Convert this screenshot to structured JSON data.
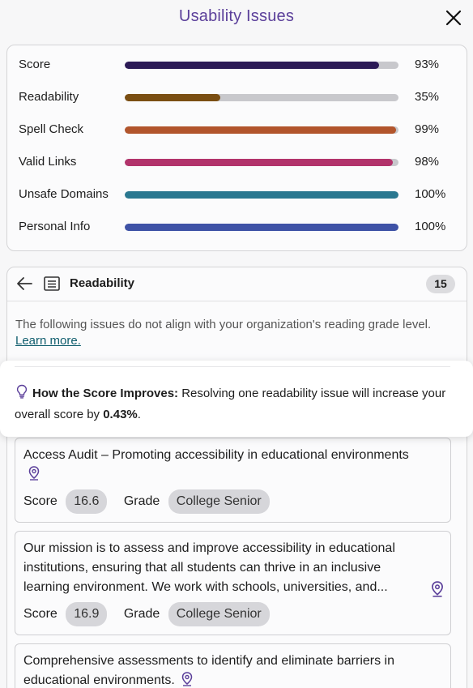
{
  "header": {
    "title": "Usability Issues"
  },
  "metrics": [
    {
      "label": "Score",
      "value": 93,
      "pct": "93%",
      "color": "#2c1a56"
    },
    {
      "label": "Readability",
      "value": 35,
      "pct": "35%",
      "color": "#7a4e12"
    },
    {
      "label": "Spell Check",
      "value": 99,
      "pct": "99%",
      "color": "#b2552c"
    },
    {
      "label": "Valid Links",
      "value": 98,
      "pct": "98%",
      "color": "#b2336b"
    },
    {
      "label": "Unsafe Domains",
      "value": 100,
      "pct": "100%",
      "color": "#2a7890"
    },
    {
      "label": "Personal Info",
      "value": 100,
      "pct": "100%",
      "color": "#3e52a6"
    }
  ],
  "issues": {
    "title": "Readability",
    "count": "15",
    "description": "The following issues do not align with your organization's reading grade level.",
    "learn_more": "Learn more.",
    "how_label": "How the Score Improves:",
    "how_text_1": "Resolving one readability issue will increase your overall score by",
    "how_value": "0.43%",
    "how_text_end": ".",
    "score_label": "Score",
    "grade_label": "Grade",
    "items": [
      {
        "text": "Access Audit – Promoting accessibility in educational environments",
        "score": "16.6",
        "grade": "College Senior"
      },
      {
        "text": "Our mission is to assess and improve accessibility in educational institutions, ensuring that all students can thrive in an inclusive learning environment. We work with schools, universities, and...",
        "score": "16.9",
        "grade": "College Senior"
      },
      {
        "text": "Comprehensive assessments to identify and eliminate barriers in educational environments."
      }
    ]
  }
}
